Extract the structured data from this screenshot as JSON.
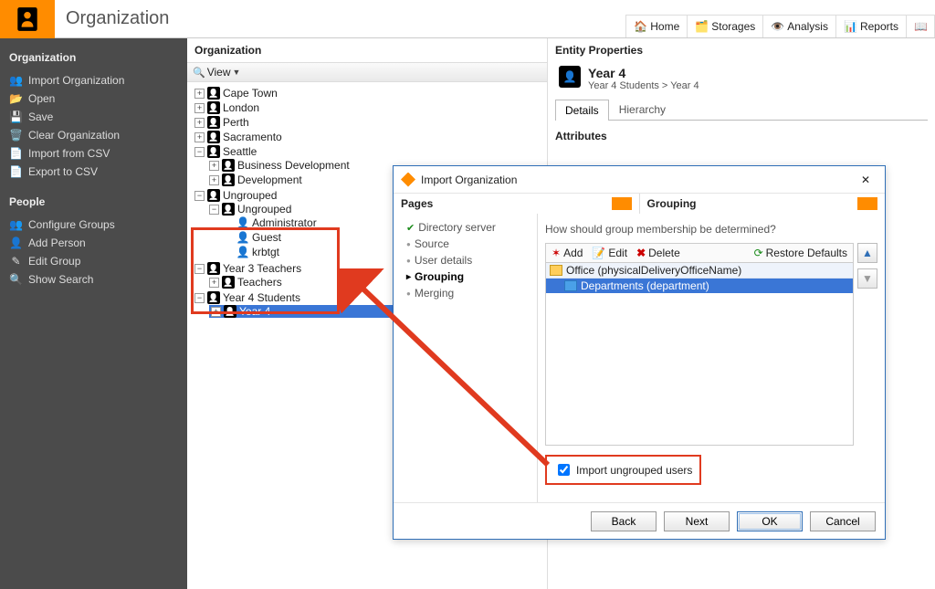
{
  "header": {
    "title": "Organization",
    "tabs": [
      {
        "icon": "home",
        "label": "Home"
      },
      {
        "icon": "folder",
        "label": "Storages"
      },
      {
        "icon": "eye",
        "label": "Analysis"
      },
      {
        "icon": "chart",
        "label": "Reports"
      },
      {
        "icon": "book",
        "label": ""
      }
    ]
  },
  "sidebar": {
    "section1": "Organization",
    "items1": [
      {
        "icon": "import",
        "label": "Import Organization"
      },
      {
        "icon": "open",
        "label": "Open"
      },
      {
        "icon": "save",
        "label": "Save"
      },
      {
        "icon": "clear",
        "label": "Clear Organization"
      },
      {
        "icon": "csvin",
        "label": "Import from CSV"
      },
      {
        "icon": "csvout",
        "label": "Export to CSV"
      }
    ],
    "section2": "People",
    "items2": [
      {
        "icon": "groups",
        "label": "Configure Groups"
      },
      {
        "icon": "addp",
        "label": "Add Person"
      },
      {
        "icon": "editg",
        "label": "Edit Group"
      },
      {
        "icon": "search",
        "label": "Show Search"
      }
    ]
  },
  "tree": {
    "title": "Organization",
    "view_label": "View",
    "nodes": {
      "capetown": "Cape Town",
      "london": "London",
      "perth": "Perth",
      "sacramento": "Sacramento",
      "seattle": "Seattle",
      "seattle_children": [
        "Business Development",
        "Development"
      ],
      "ungrouped": "Ungrouped",
      "ungrouped_inner": "Ungrouped",
      "ungrouped_users": [
        "Administrator",
        "Guest",
        "krbtgt"
      ],
      "y3": "Year 3 Teachers",
      "y3_children": [
        "Teachers"
      ],
      "y4": "Year 4 Students",
      "y4_children": [
        "Year 4"
      ]
    }
  },
  "entity": {
    "panel_title": "Entity Properties",
    "name": "Year 4",
    "path": "Year 4 Students > Year 4",
    "tab_details": "Details",
    "tab_hierarchy": "Hierarchy",
    "attributes_label": "Attributes"
  },
  "dialog": {
    "title": "Import Organization",
    "left_header": "Pages",
    "steps": [
      {
        "state": "done",
        "label": "Directory server"
      },
      {
        "state": "dot",
        "label": "Source"
      },
      {
        "state": "dot",
        "label": "User details"
      },
      {
        "state": "active",
        "label": "Grouping"
      },
      {
        "state": "dot",
        "label": "Merging"
      }
    ],
    "right_header": "Grouping",
    "question": "How should group membership be determined?",
    "toolbar": {
      "add": "Add",
      "edit": "Edit",
      "delete": "Delete",
      "restore": "Restore Defaults"
    },
    "groups": {
      "root": "Office (physicalDeliveryOfficeName)",
      "child": "Departments (department)"
    },
    "checkbox_label": "Import ungrouped users",
    "buttons": {
      "back": "Back",
      "next": "Next",
      "ok": "OK",
      "cancel": "Cancel"
    }
  }
}
